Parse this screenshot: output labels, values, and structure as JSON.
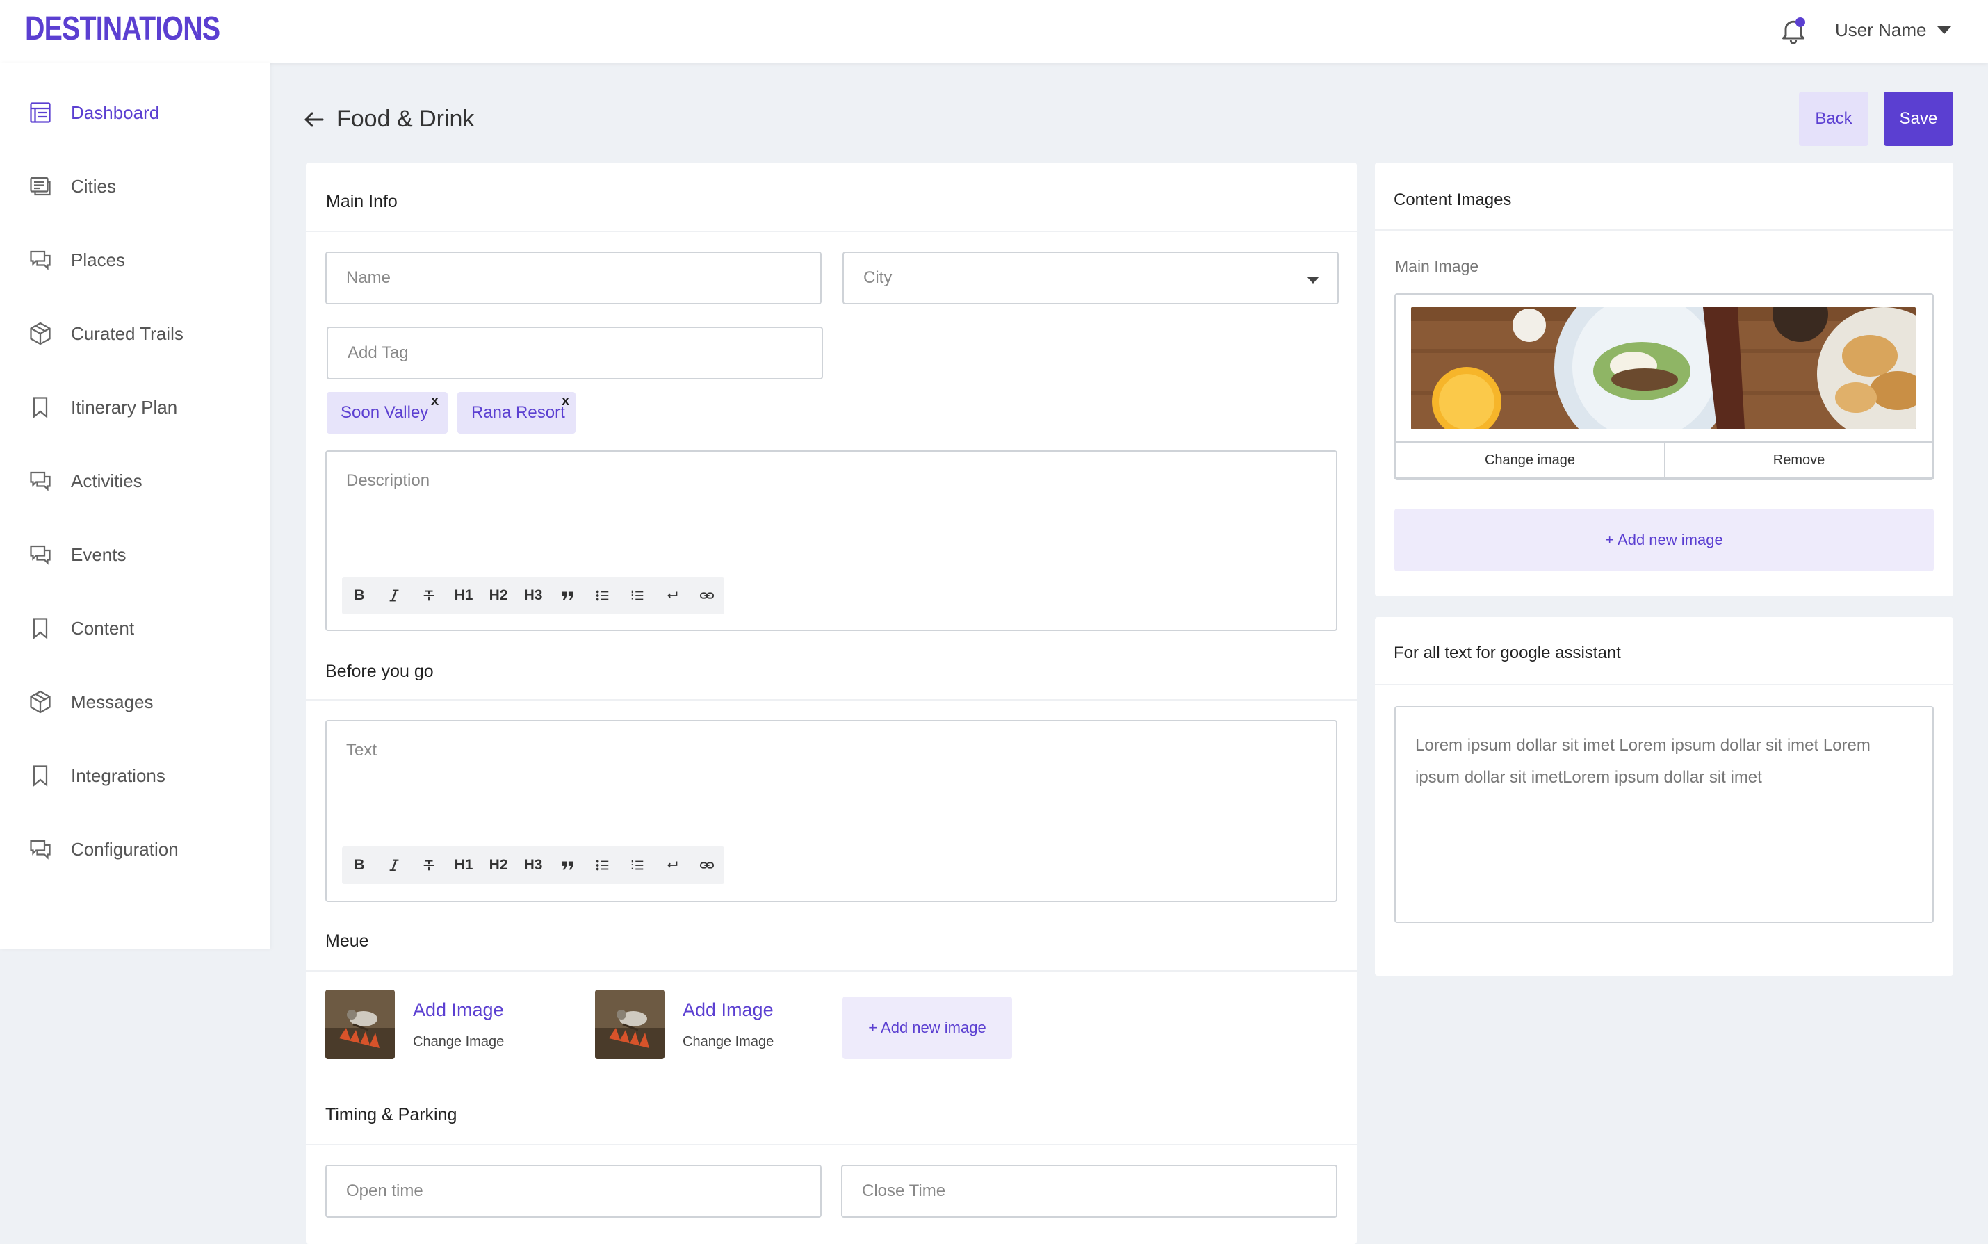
{
  "app": {
    "logo": "DESTINATIONS"
  },
  "header": {
    "user_name": "User Name"
  },
  "sidebar": {
    "items": [
      {
        "label": "Dashboard",
        "icon": "dashboard-icon",
        "active": true
      },
      {
        "label": "Cities",
        "icon": "cities-icon"
      },
      {
        "label": "Places",
        "icon": "chat-icon"
      },
      {
        "label": "Curated Trails",
        "icon": "box-icon"
      },
      {
        "label": "Itinerary Plan",
        "icon": "bookmark-icon"
      },
      {
        "label": "Activities",
        "icon": "chat-icon"
      },
      {
        "label": "Events",
        "icon": "chat-icon"
      },
      {
        "label": "Content",
        "icon": "bookmark-icon"
      },
      {
        "label": "Messages",
        "icon": "box-icon"
      },
      {
        "label": "Integrations",
        "icon": "bookmark-icon"
      },
      {
        "label": "Configuration",
        "icon": "chat-icon"
      }
    ]
  },
  "page": {
    "title": "Food & Drink",
    "back_label": "Back",
    "save_label": "Save"
  },
  "main_info": {
    "title": "Main Info",
    "name_placeholder": "Name",
    "city_placeholder": "City",
    "tag_placeholder": "Add Tag",
    "tags": [
      {
        "label": "Soon Valley",
        "remove": "x"
      },
      {
        "label": "Rana Resort",
        "remove": "x"
      }
    ],
    "description_placeholder": "Description"
  },
  "toolbar": {
    "h1": "H1",
    "h2": "H2",
    "h3": "H3"
  },
  "before_you_go": {
    "title": "Before you go",
    "text_placeholder": "Text"
  },
  "menu": {
    "title": "Meue",
    "items": [
      {
        "add_label": "Add Image",
        "change_label": "Change Image"
      },
      {
        "add_label": "Add Image",
        "change_label": "Change Image"
      }
    ],
    "add_new_label": "+ Add new image"
  },
  "timing": {
    "title": "Timing & Parking",
    "open_placeholder": "Open time",
    "close_placeholder": "Close Time"
  },
  "content_images": {
    "title": "Content Images",
    "main_image_label": "Main Image",
    "change_label": "Change image",
    "remove_label": "Remove",
    "add_new_label": "+ Add new image"
  },
  "assistant": {
    "title": "For all text for google assistant",
    "text": "Lorem ipsum dollar sit imet Lorem ipsum dollar sit imet Lorem ipsum dollar sit imetLorem ipsum dollar sit imet"
  },
  "colors": {
    "accent": "#5b3fd1",
    "accent_light": "#e7e4fa",
    "background": "#eef1f5"
  }
}
